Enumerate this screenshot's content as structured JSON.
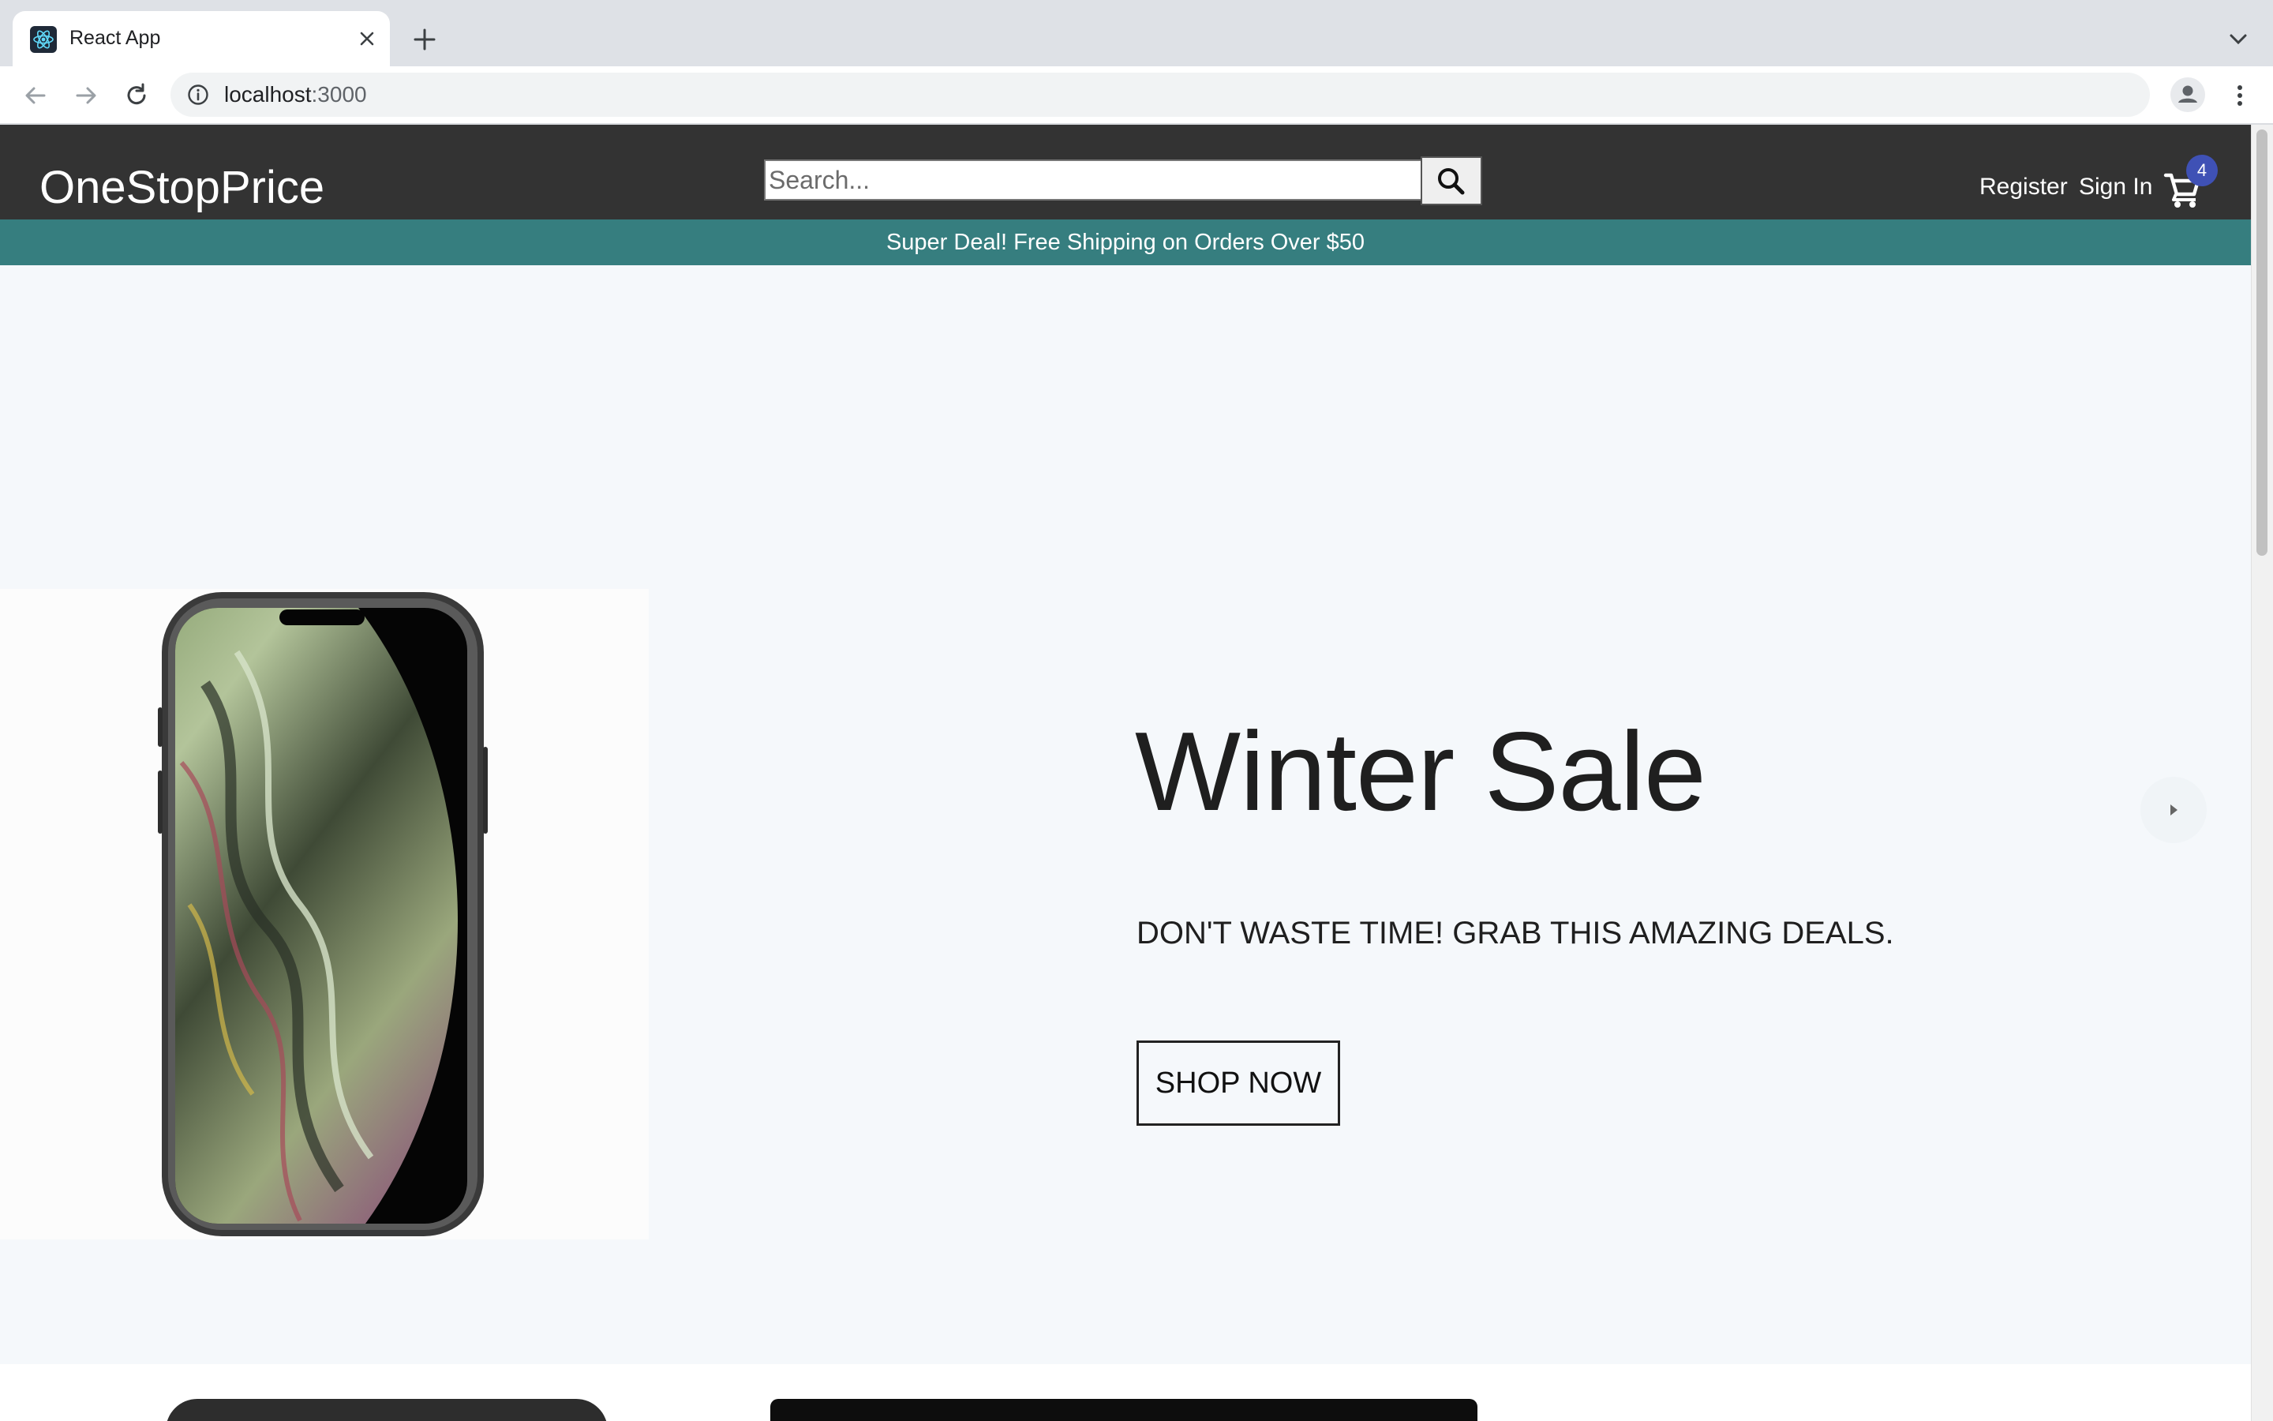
{
  "browser": {
    "tab_title": "React App",
    "url_host": "localhost",
    "url_port": ":3000"
  },
  "navbar": {
    "brand": "OneStopPrice",
    "search_placeholder": "Search...",
    "register_label": "Register",
    "signin_label": "Sign In",
    "cart_count": "4"
  },
  "promo": {
    "text": "Super Deal! Free Shipping on Orders Over $50"
  },
  "hero": {
    "title": "Winter Sale",
    "subtitle": "DON'T WASTE TIME! GRAB THIS AMAZING DEALS.",
    "button_label": "SHOP NOW"
  },
  "colors": {
    "navbar_bg": "#333333",
    "promo_bg": "#367e7f",
    "hero_bg": "#f5f8fb",
    "cart_badge": "#3f51b5"
  },
  "icons": [
    "react-favicon-icon",
    "close-icon",
    "plus-icon",
    "chevron-down-icon",
    "arrow-left-icon",
    "arrow-right-icon",
    "reload-icon",
    "info-icon",
    "star-icon",
    "profile-icon",
    "more-vert-icon",
    "search-icon",
    "shopping-cart-icon",
    "caret-left-icon",
    "caret-right-icon"
  ]
}
